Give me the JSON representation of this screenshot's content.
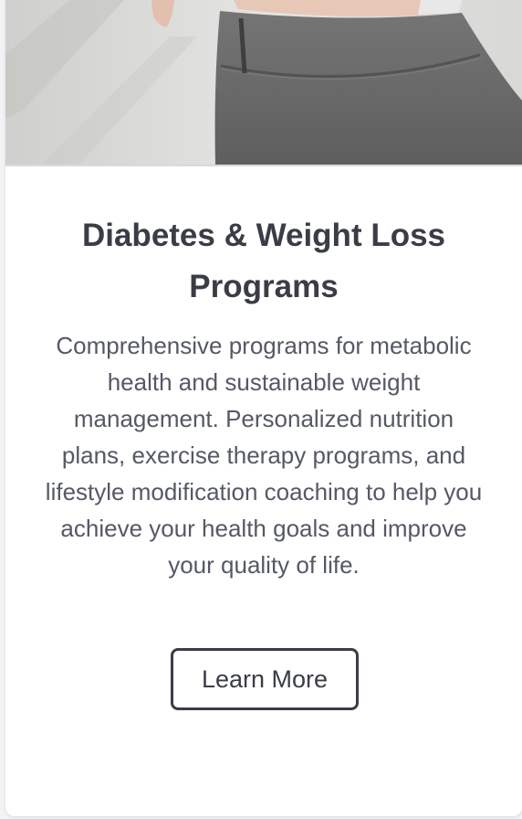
{
  "card": {
    "image": {
      "icon": "hero-photo-woman-waist-gray-leggings",
      "colors": {
        "background": "#dcdcda",
        "fabric": "#6b6b6b",
        "skin": "#e9c9b8"
      }
    },
    "title": "Diabetes & Weight Loss Programs",
    "description": "Comprehensive programs for metabolic health and sustainable weight management. Personalized nutrition plans, exercise therapy programs, and lifestyle modification coaching to help you achieve your health goals and improve your quality of life.",
    "button_label": "Learn More"
  },
  "colors": {
    "page_background": "#f2f3f5",
    "card_background": "#ffffff",
    "title_text": "#3a3d46",
    "body_text": "#555965",
    "button_border": "#3a3d46"
  }
}
